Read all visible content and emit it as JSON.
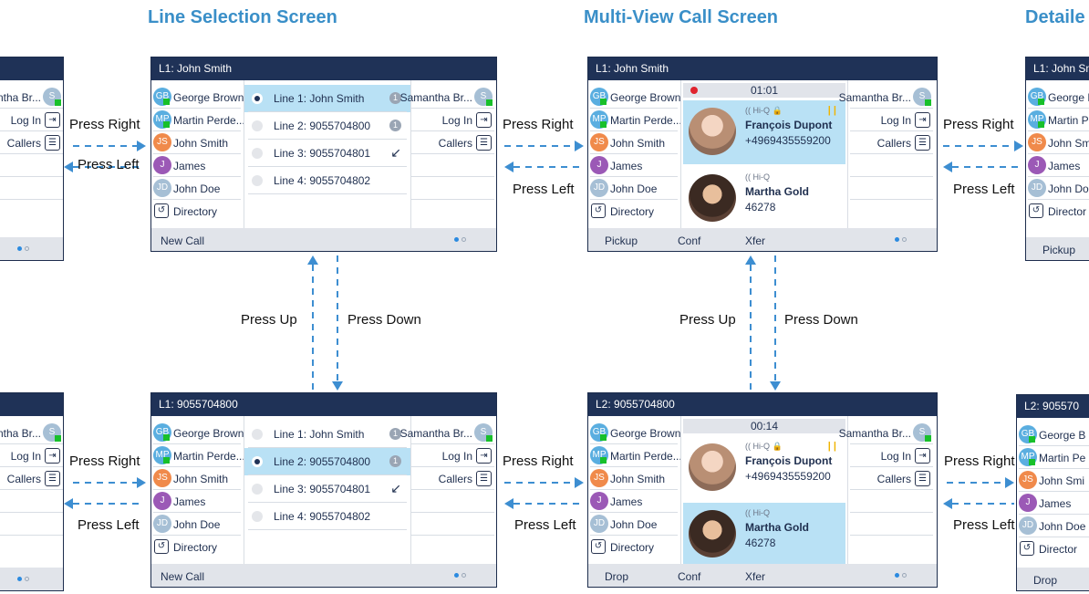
{
  "titles": {
    "line_selection": "Line Selection Screen",
    "multi_view": "Multi-View Call Screen",
    "detailed": "Detaile"
  },
  "contacts": {
    "left": [
      {
        "initials": "GB",
        "name": "George Brown",
        "color": "#5aaee0",
        "presence": true
      },
      {
        "initials": "MP",
        "name": "Martin Perde...",
        "color": "#5aaee0",
        "presence": true
      },
      {
        "initials": "JS",
        "name": "John Smith",
        "color": "#f08a4b",
        "presence": false
      },
      {
        "initials": "J",
        "name": "James",
        "color": "#9b59b6",
        "presence": false
      },
      {
        "initials": "JD",
        "name": "John Doe",
        "color": "#a6bfd5",
        "presence": false
      },
      {
        "initials": "",
        "name": "Directory",
        "color": "",
        "presence": false
      }
    ],
    "right": [
      {
        "name": "Samantha Br...",
        "initials": "S"
      },
      {
        "name": "Log In",
        "icon": "⇥"
      },
      {
        "name": "Callers",
        "icon": "☰"
      }
    ]
  },
  "screen_a": {
    "header": "L1: John Smith",
    "lines": [
      {
        "label": "Line 1: John Smith",
        "selected": true,
        "badge": "1"
      },
      {
        "label": "Line 2: 9055704800",
        "selected": false,
        "badge": "1"
      },
      {
        "label": "Line 3: 9055704801",
        "selected": false,
        "badge": "↙"
      },
      {
        "label": "Line 4: 9055704802",
        "selected": false,
        "badge": ""
      }
    ],
    "footer": [
      "New Call"
    ]
  },
  "screen_b": {
    "header": "L1: 9055704800",
    "lines": [
      {
        "label": "Line 1: John Smith",
        "selected": false,
        "badge": "1"
      },
      {
        "label": "Line 2: 9055704800",
        "selected": true,
        "badge": "1"
      },
      {
        "label": "Line 3: 9055704801",
        "selected": false,
        "badge": "↙"
      },
      {
        "label": "Line 4: 9055704802",
        "selected": false,
        "badge": ""
      }
    ],
    "footer": [
      "New Call"
    ]
  },
  "screen_c": {
    "header": "L1: John Smith",
    "timer": "01:01",
    "calls": [
      {
        "name": "François Dupont",
        "number": "+4969435559200",
        "tag": "Hi-Q",
        "active": true
      },
      {
        "name": "Martha Gold",
        "number": "46278",
        "tag": "Hi-Q",
        "active": false
      }
    ],
    "footer": [
      "Pickup",
      "Conf",
      "Xfer"
    ]
  },
  "screen_d": {
    "header": "L2: 9055704800",
    "timer": "00:14",
    "calls": [
      {
        "name": "François Dupont",
        "number": "+4969435559200",
        "tag": "Hi-Q",
        "active": false
      },
      {
        "name": "Martha Gold",
        "number": "46278",
        "tag": "Hi-Q",
        "active": true
      }
    ],
    "footer": [
      "Drop",
      "Conf",
      "Xfer"
    ]
  },
  "partial_left": {
    "top_name": "ntha Br...",
    "log_in": "Log In",
    "callers": "Callers"
  },
  "partial_right": {
    "header_top": "L1: John Sm",
    "header_bottom": "L2: 905570",
    "names": [
      "George B",
      "Martin Pe",
      "John Smi",
      "James",
      "John Doe",
      "Director"
    ],
    "footer_top": "Pickup",
    "footer_bottom": "Drop"
  },
  "labels": {
    "press_right": "Press Right",
    "press_left": "Press Left",
    "press_up": "Press Up",
    "press_down": "Press Down"
  },
  "colors": {
    "header_bg": "#1f3257",
    "title_blue": "#3a8fc8",
    "arrow_blue": "#3d8ed1",
    "selection": "#b9e1f5"
  }
}
